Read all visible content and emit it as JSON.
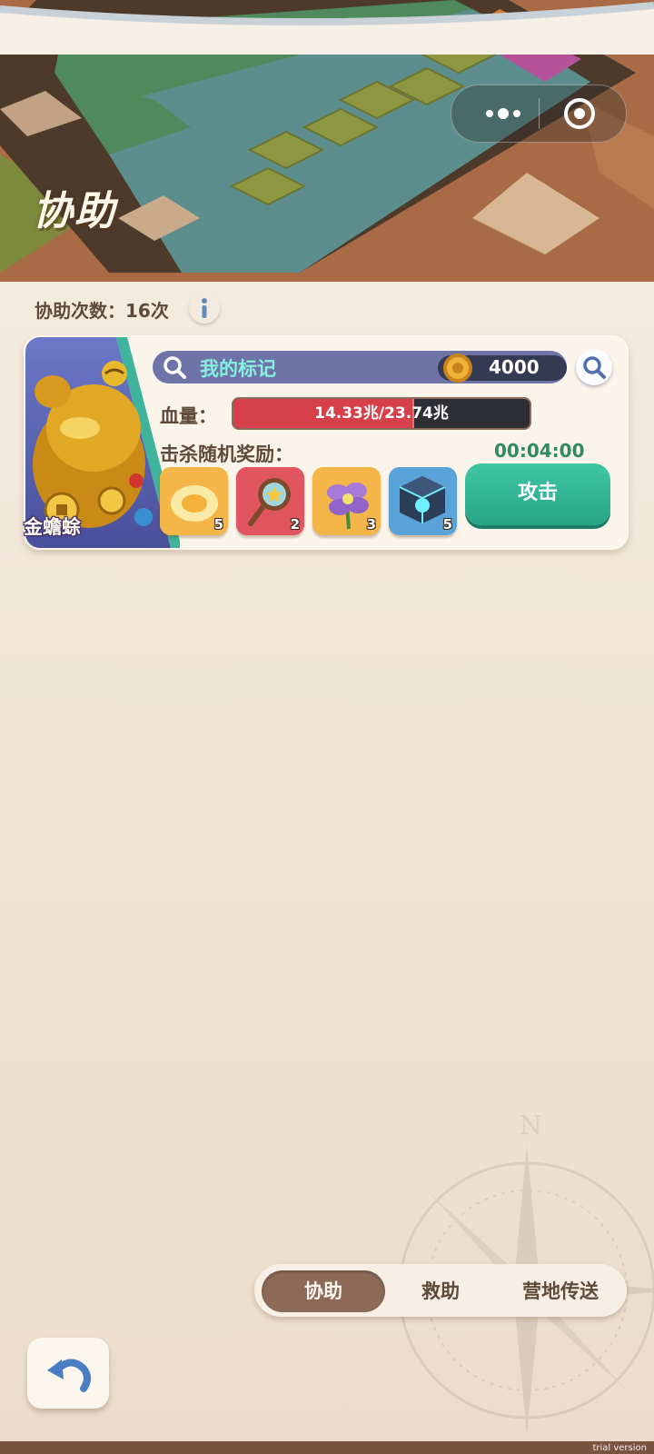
{
  "header": {
    "title": "协助",
    "capsule": {
      "more_icon": "more-dots-icon",
      "close_icon": "target-circle-icon"
    }
  },
  "assist": {
    "count_label": "协助次数：16次",
    "info_icon": "info-icon"
  },
  "boss": {
    "name": "金蟾蜍",
    "search_text": "我的标记",
    "coin_value": "4000",
    "hp_label": "血量：",
    "hp_text": "14.33兆/23.74兆",
    "hp_fraction": 0.604,
    "reward_label": "击杀随机奖励：",
    "timer": "00:04:00",
    "attack_label": "攻击",
    "rewards": [
      {
        "icon": "egg-icon",
        "count": "5",
        "bg": "#f5b649"
      },
      {
        "icon": "magnifier-star-icon",
        "count": "2",
        "bg": "#e05560"
      },
      {
        "icon": "purple-flower-icon",
        "count": "3",
        "bg": "#f5b649"
      },
      {
        "icon": "treasure-cube-icon",
        "count": "5",
        "bg": "#5aa3d8"
      }
    ]
  },
  "tabs": [
    {
      "label": "协助",
      "active": true
    },
    {
      "label": "救助",
      "active": false
    },
    {
      "label": "营地传送",
      "active": false
    }
  ],
  "footer": {
    "back_icon": "undo-arrow-icon",
    "watermark": "trial version"
  },
  "colors": {
    "accent_green": "#2fb894",
    "hp_red": "#d6404a",
    "tab_active": "#8d6a58"
  }
}
